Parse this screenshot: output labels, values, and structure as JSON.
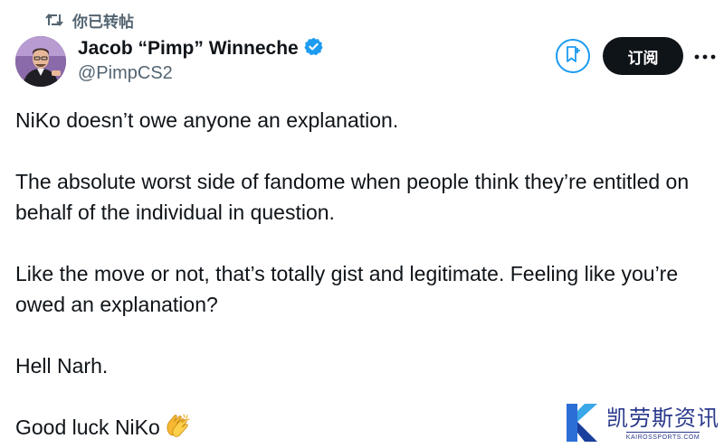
{
  "repost": {
    "icon": "repost-icon",
    "label": "你已转帖"
  },
  "author": {
    "display_name": "Jacob “Pimp” Winneche",
    "handle": "@PimpCS2",
    "verified_icon": "verified-badge-icon",
    "verified_color": "#1d9bf0"
  },
  "actions": {
    "bookmark_icon": "bookmark-add-icon",
    "subscribe_label": "订阅",
    "more_icon": "more-horizontal-icon"
  },
  "tweet": {
    "paragraphs": [
      "NiKo doesn’t owe anyone an explanation.",
      "The absolute worst side of fandome when people think they’re entitled on behalf of the individual in question.",
      "Like the move or not, that’s totally gist and legitimate. Feeling like you’re owed an explanation?",
      "Hell Narh."
    ],
    "last_line": "Good luck NiKo",
    "last_emoji": "clapping-hands-emoji"
  },
  "watermark": {
    "logo_icon": "kairos-k-logo",
    "text_cn": "凯劳斯资讯",
    "text_en": "KAIROSSPORTS.COM"
  },
  "colors": {
    "text_primary": "#0f1419",
    "text_secondary": "#536471",
    "accent": "#1d9bf0",
    "button_dark": "#0f1419",
    "watermark": "#2b3a8c"
  }
}
